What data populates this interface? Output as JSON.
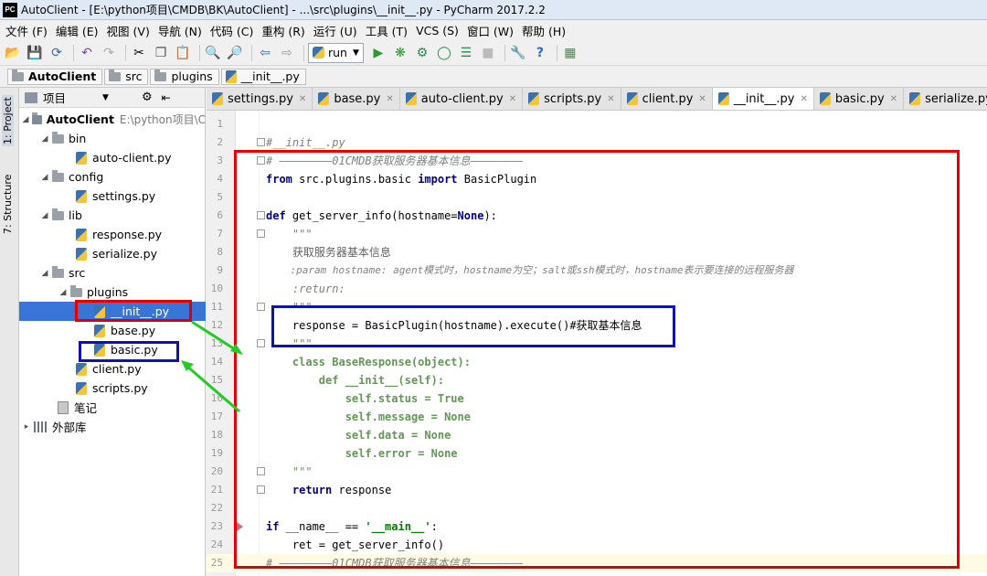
{
  "window": {
    "title": "AutoClient - [E:\\python项目\\CMDB\\BK\\AutoClient] - ...\\src\\plugins\\__init__.py - PyCharm 2017.2.2",
    "logo_text": "PC"
  },
  "menu": [
    "文件 (F)",
    "编辑 (E)",
    "视图 (V)",
    "导航 (N)",
    "代码 (C)",
    "重构 (R)",
    "运行 (U)",
    "工具 (T)",
    "VCS (S)",
    "窗口 (W)",
    "帮助 (H)"
  ],
  "toolbar": {
    "run_config": "run"
  },
  "breadcrumb": [
    "AutoClient",
    "src",
    "plugins",
    "__init__.py"
  ],
  "side_tabs": {
    "project": "1: Project",
    "structure": "7: Structure"
  },
  "project_panel": {
    "header": "项目",
    "root_name": "AutoClient",
    "root_path": "E:\\python项目\\C",
    "items": [
      "bin",
      "auto-client.py",
      "config",
      "settings.py",
      "lib",
      "response.py",
      "serialize.py",
      "src",
      "plugins",
      "__init__.py",
      "base.py",
      "basic.py",
      "client.py",
      "scripts.py",
      "笔记",
      "外部库"
    ]
  },
  "tabs": [
    "settings.py",
    "base.py",
    "auto-client.py",
    "scripts.py",
    "client.py",
    "__init__.py",
    "basic.py",
    "serialize.py"
  ],
  "active_tab": "__init__.py",
  "code": {
    "line_numbers": [
      "1",
      "2",
      "3",
      "4",
      "5",
      "6",
      "7",
      "8",
      "9",
      "10",
      "11",
      "12",
      "13",
      "14",
      "15",
      "16",
      "17",
      "18",
      "19",
      "20",
      "21",
      "22",
      "23",
      "24",
      "25"
    ],
    "lines": [
      "",
      "#__init__.py",
      "# ————————01CMDB获取服务器基本信息————————",
      "from src.plugins.basic import BasicPlugin",
      "",
      "def get_server_info(hostname=None):",
      "    \"\"\"",
      "    获取服务器基本信息",
      "    :param hostname: agent模式时，hostname为空；salt或ssh模式时，hostname表示要连接的远程服务器",
      "    :return:",
      "    \"\"\"",
      "    response = BasicPlugin(hostname).execute()#获取基本信息",
      "    \"\"\"",
      "    class BaseResponse(object):",
      "        def __init__(self):",
      "            self.status = True",
      "            self.message = None",
      "            self.data = None",
      "            self.error = None",
      "    \"\"\"",
      "    return response",
      "",
      "if __name__ == '__main__':",
      "    ret = get_server_info()",
      "# ————————01CMDB获取服务器基本信息————————"
    ]
  },
  "colors": {
    "annotation_red": "#e00000",
    "annotation_blue": "#1010b0",
    "annotation_green": "#22cc22",
    "selection": "#3875d7"
  }
}
